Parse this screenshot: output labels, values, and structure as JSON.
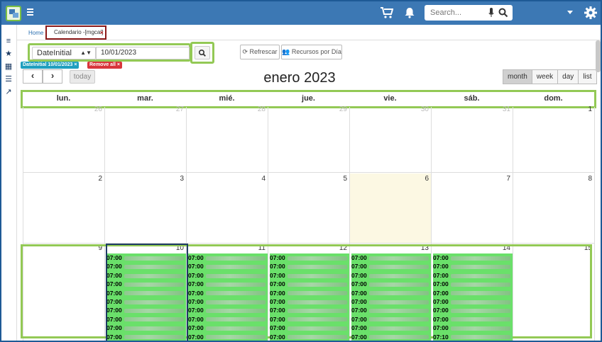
{
  "topbar": {
    "search_placeholder": "Search...",
    "icons": [
      "app-logo-icon",
      "menu-icon",
      "cart-icon",
      "bell-icon",
      "microphone-icon",
      "search-icon",
      "chevron-down-icon",
      "gear-icon"
    ]
  },
  "rail": {
    "icons": [
      "list-icon",
      "star-icon",
      "calendar-icon",
      "table-icon",
      "chart-icon"
    ]
  },
  "tabs": {
    "home": "Home",
    "calendar": "Calendario -[mgcal]",
    "close": "×"
  },
  "filter": {
    "field": "DateInitial",
    "value": "10/01/2023"
  },
  "toolbar": {
    "refresh": "Refrescar",
    "resources": "Recursos por Día"
  },
  "chips": {
    "active_filter": "DateInitial 10/01/2023 ×",
    "remove_all": "Remove all ×"
  },
  "nav": {
    "prev": "‹",
    "next": "›",
    "today": "today"
  },
  "calendar": {
    "title": "enero 2023",
    "views": [
      "month",
      "week",
      "day",
      "list"
    ],
    "active_view": "month",
    "weekdays": [
      "lun.",
      "mar.",
      "mié.",
      "jue.",
      "vie.",
      "sáb.",
      "dom."
    ],
    "week1": [
      "26",
      "27",
      "28",
      "29",
      "30",
      "31",
      "1"
    ],
    "week2": [
      "2",
      "3",
      "4",
      "5",
      "6",
      "7",
      "8"
    ],
    "week3": [
      "9",
      "10",
      "11",
      "12",
      "13",
      "14",
      "15"
    ],
    "today": "6",
    "event_time": "07:00",
    "last_event_time": "07:10"
  }
}
